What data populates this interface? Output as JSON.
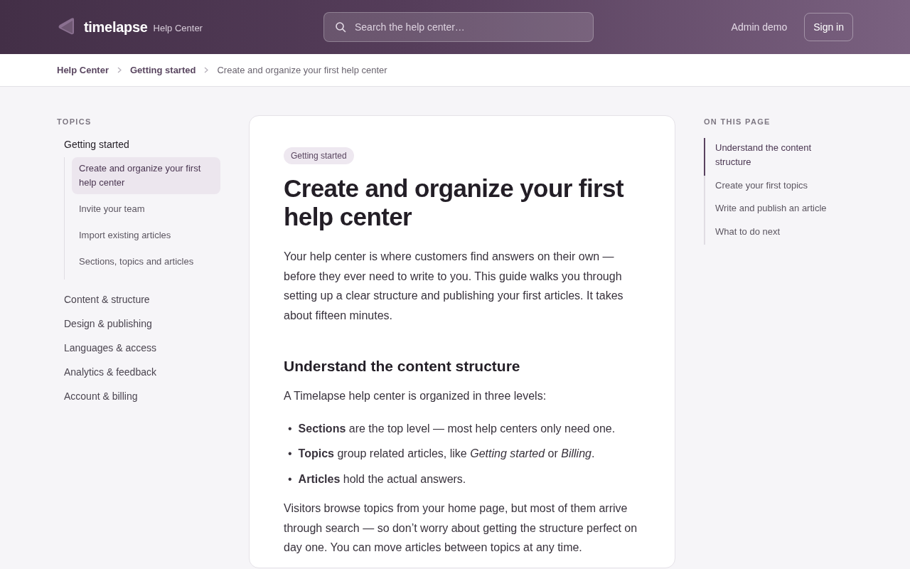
{
  "header": {
    "brand": "timelapse",
    "brand_suffix": "Help Center",
    "search": {
      "placeholder": "Search the help center…"
    },
    "user_link": "Admin demo",
    "sign_in": "Sign in"
  },
  "breadcrumbs": [
    {
      "label": "Help Center",
      "current": false
    },
    {
      "label": "Getting started",
      "current": false
    },
    {
      "label": "Create and organize your first help center",
      "current": true
    }
  ],
  "sidebar": {
    "heading": "TOPICS",
    "topics": [
      {
        "label": "Getting started",
        "expanded": true,
        "children": [
          {
            "label": "Create and organize your first help center",
            "selected": true
          },
          {
            "label": "Invite your team",
            "selected": false
          },
          {
            "label": "Import existing articles",
            "selected": false
          },
          {
            "label": "Sections, topics and articles",
            "selected": false
          }
        ]
      },
      {
        "label": "Content & structure",
        "expanded": false
      },
      {
        "label": "Design & publishing",
        "expanded": false
      },
      {
        "label": "Languages & access",
        "expanded": false
      },
      {
        "label": "Analytics & feedback",
        "expanded": false
      },
      {
        "label": "Account & billing",
        "expanded": false
      }
    ]
  },
  "article": {
    "tag": "Getting started",
    "title": "Create and organize your first help center",
    "blocks": [
      {
        "kind": "paragraph",
        "text": "Your help center is where customers find answers on their own — before they ever need to write to you. This guide walks you through setting up a clear structure and publishing your first articles. It takes about fifteen minutes."
      },
      {
        "kind": "heading",
        "text": "Understand the content structure"
      },
      {
        "kind": "paragraph",
        "text": "A Timelapse help center is organized in three levels:"
      },
      {
        "kind": "list",
        "marker": "•",
        "items": [
          "**Sections** are the top level — most help centers only need one.",
          "**Topics** group related articles, like *Getting started* or *Billing*.",
          "**Articles** hold the actual answers."
        ]
      },
      {
        "kind": "paragraph",
        "text": "Visitors browse topics from your home page, but most of them arrive through search — so don’t worry about getting the structure perfect on day one. You can move articles between topics at any time."
      }
    ]
  },
  "toc": {
    "heading": "ON THIS PAGE",
    "items": [
      {
        "label": "Understand the content structure",
        "selected": true
      },
      {
        "label": "Create your first topics",
        "selected": false
      },
      {
        "label": "Write and publish an article",
        "selected": false
      },
      {
        "label": "What to do next",
        "selected": false
      }
    ]
  }
}
